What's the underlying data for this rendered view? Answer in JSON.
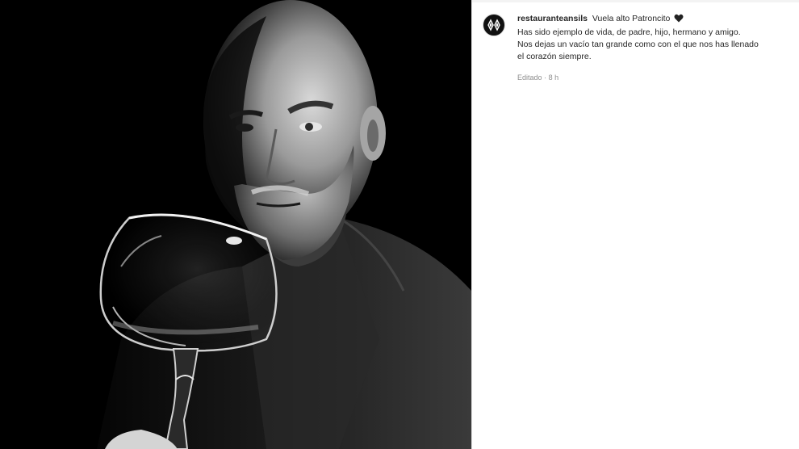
{
  "post": {
    "username": "restauranteansils",
    "caption_first": "Vuela alto Patroncito",
    "caption_lines": [
      "Has sido ejemplo de vida, de padre, hijo, hermano y amigo.",
      "Nos dejas un vacío tan grande como con el que nos has llenado",
      "el corazón siempre."
    ],
    "edited_label": "Editado",
    "separator": "·",
    "time_ago": "8 h"
  },
  "icons": {
    "avatar": "diamond-logo-icon",
    "heart": "black-heart-icon"
  },
  "colors": {
    "text": "#262626",
    "muted": "#8e8e8e",
    "photo_bg": "#000000"
  }
}
